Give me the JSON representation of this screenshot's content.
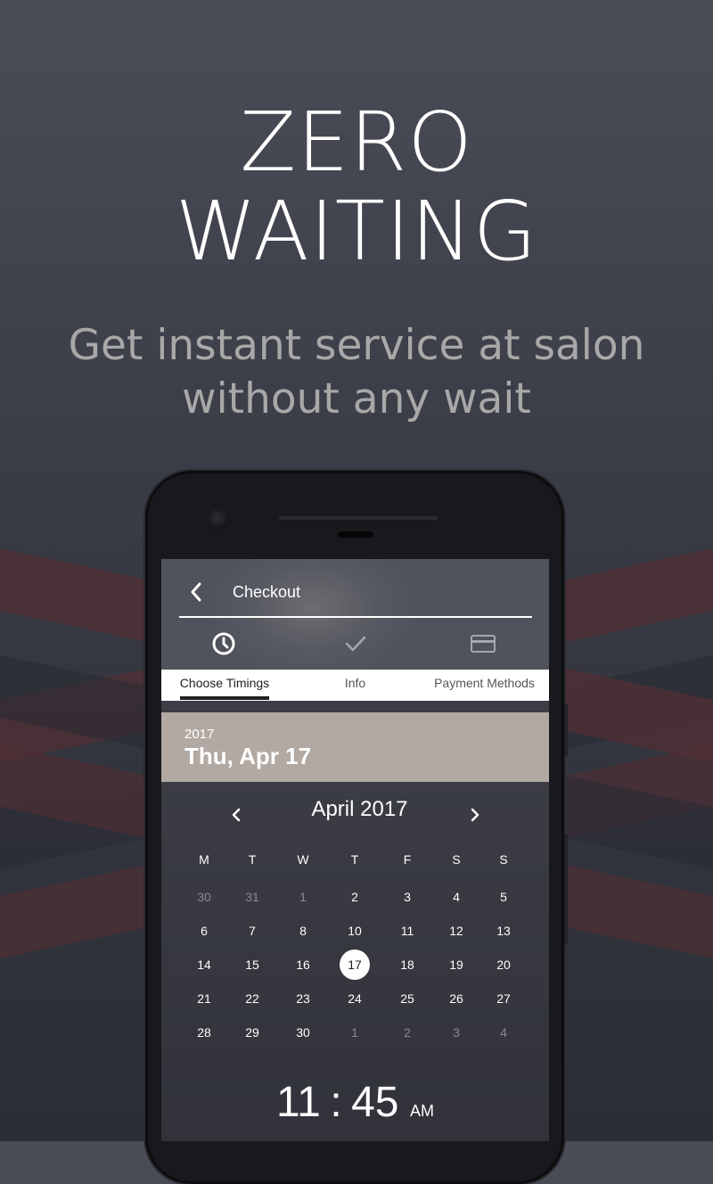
{
  "promo": {
    "headline_line1": "ZERO",
    "headline_line2": "WAITING",
    "subtitle_line1": "Get instant service at salon",
    "subtitle_line2": "without any wait"
  },
  "app": {
    "toolbar": {
      "title": "Checkout",
      "back_icon": "chevron-left-icon"
    },
    "steps": [
      {
        "icon": "clock-icon",
        "label": "Choose Timings",
        "active": true
      },
      {
        "icon": "check-icon",
        "label": "Info",
        "active": false
      },
      {
        "icon": "credit-card-icon",
        "label": "Payment Methods",
        "active": false
      }
    ],
    "date_header": {
      "year": "2017",
      "selected_date": "Thu, Apr 17"
    },
    "calendar": {
      "month_label": "April 2017",
      "weekdays": [
        "M",
        "T",
        "W",
        "T",
        "F",
        "S",
        "S"
      ],
      "weeks": [
        [
          "30",
          "31",
          "1",
          "2",
          "3",
          "4",
          "5"
        ],
        [
          "6",
          "7",
          "8",
          "10",
          "11",
          "12",
          "13"
        ],
        [
          "14",
          "15",
          "16",
          "17",
          "18",
          "19",
          "20"
        ],
        [
          "21",
          "22",
          "23",
          "24",
          "25",
          "26",
          "27"
        ],
        [
          "28",
          "29",
          "30",
          "1",
          "2",
          "3",
          "4"
        ]
      ],
      "other_month_cells": [
        [
          0,
          0
        ],
        [
          0,
          1
        ],
        [
          0,
          2
        ],
        [
          4,
          3
        ],
        [
          4,
          4
        ],
        [
          4,
          5
        ],
        [
          4,
          6
        ]
      ],
      "selected_cell": [
        2,
        3
      ]
    },
    "time": {
      "hour": "11",
      "separator": ":",
      "minute": "45",
      "ampm": "AM"
    }
  },
  "colors": {
    "background_top": "#4a4c58",
    "background_bottom": "#2c2e36",
    "stripe_red": "#5a3034",
    "stripe_dark": "#2a2b33",
    "date_header": "#b2a9a3",
    "subtitle_gray": "#a8a8a8"
  }
}
